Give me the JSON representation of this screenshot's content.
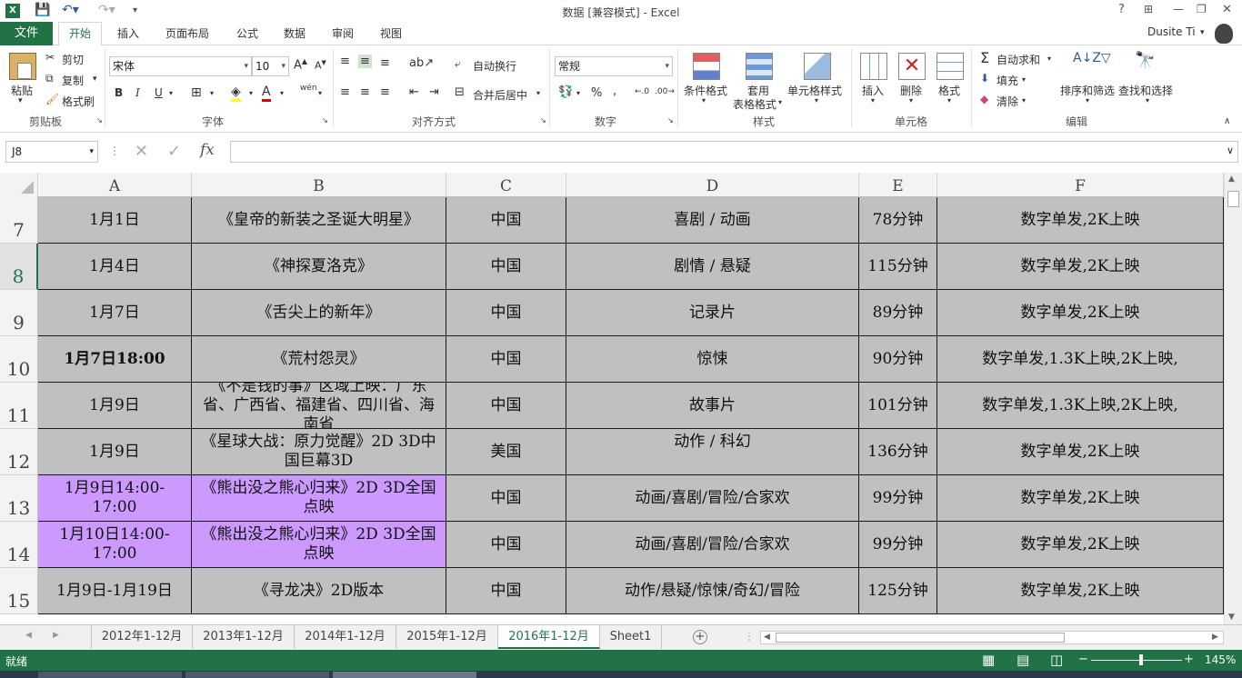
{
  "window": {
    "title": "数据  [兼容模式] - Excel",
    "controls": [
      "?",
      "⊞",
      "—",
      "❐",
      "✕"
    ]
  },
  "ribbon_tabs": [
    "文件",
    "开始",
    "插入",
    "页面布局",
    "公式",
    "数据",
    "审阅",
    "视图"
  ],
  "user": "Dusite Ti",
  "clipboard": {
    "paste": "粘贴",
    "cut": "剪切",
    "copy": "复制",
    "format_painter": "格式刷",
    "label": "剪贴板"
  },
  "font": {
    "name": "宋体",
    "size": "10",
    "label": "字体",
    "wen": "wén"
  },
  "alignment": {
    "wrap": "自动换行",
    "merge": "合并后居中",
    "label": "对齐方式"
  },
  "number": {
    "format": "常规",
    "label": "数字"
  },
  "styles": {
    "cond": "条件格式",
    "table1": "套用",
    "table2": "表格格式",
    "cell": "单元格样式",
    "label": "样式"
  },
  "cells": {
    "insert": "插入",
    "delete": "删除",
    "format": "格式",
    "label": "单元格"
  },
  "editing": {
    "autosum": "自动求和",
    "fill": "填充",
    "clear": "清除",
    "sort": "排序和筛选",
    "find": "查找和选择",
    "label": "编辑"
  },
  "namebox": "J8",
  "fx": "fx",
  "columns": [
    "A",
    "B",
    "C",
    "D",
    "E",
    "F"
  ],
  "rows": [
    {
      "num": "7",
      "a": "1月1日",
      "b": "《皇帝的新装之圣诞大明星》",
      "c": "中国",
      "d": "喜剧 / 动画",
      "e": "78分钟",
      "f": "数字单发,2K上映"
    },
    {
      "num": "8",
      "a": "1月4日",
      "b": "《神探夏洛克》",
      "c": "中国",
      "d": "剧情 / 悬疑",
      "e": "115分钟",
      "f": "数字单发,2K上映"
    },
    {
      "num": "9",
      "a": "1月7日",
      "b": "《舌尖上的新年》",
      "c": "中国",
      "d": "记录片",
      "e": "89分钟",
      "f": "数字单发,2K上映"
    },
    {
      "num": "10",
      "a": "1月7日18:00",
      "b": "《荒村怨灵》",
      "c": "中国",
      "d": "惊悚",
      "e": "90分钟",
      "f": "数字单发,1.3K上映,2K上映,"
    },
    {
      "num": "11",
      "a": "1月9日",
      "b": "《不是钱的事》区域上映：广东省、广西省、福建省、四川省、海南省",
      "c": "中国",
      "d": "故事片",
      "e": "101分钟",
      "f": "数字单发,1.3K上映,2K上映,"
    },
    {
      "num": "12",
      "a": "1月9日",
      "b": "《星球大战：原力觉醒》2D 3D中国巨幕3D",
      "c": "美国",
      "d": "动作 / 科幻",
      "e": "136分钟",
      "f": "数字单发,2K上映"
    },
    {
      "num": "13",
      "a": "1月9日14:00-17:00",
      "b": "《熊出没之熊心归来》2D 3D全国点映",
      "c": "中国",
      "d": "动画/喜剧/冒险/合家欢",
      "e": "99分钟",
      "f": "数字单发,2K上映"
    },
    {
      "num": "14",
      "a": "1月10日14:00-17:00",
      "b": "《熊出没之熊心归来》2D 3D全国点映",
      "c": "中国",
      "d": "动画/喜剧/冒险/合家欢",
      "e": "99分钟",
      "f": "数字单发,2K上映"
    },
    {
      "num": "15",
      "a": "1月9日-1月19日",
      "b": "《寻龙决》2D版本",
      "c": "中国",
      "d": "动作/悬疑/惊悚/奇幻/冒险",
      "e": "125分钟",
      "f": "数字单发,2K上映"
    }
  ],
  "sheets": [
    "2012年1-12月",
    "2013年1-12月",
    "2014年1-12月",
    "2015年1-12月",
    "2016年1-12月",
    "Sheet1"
  ],
  "active_sheet": "2016年1-12月",
  "status": {
    "ready": "就绪",
    "zoom": "145%"
  }
}
